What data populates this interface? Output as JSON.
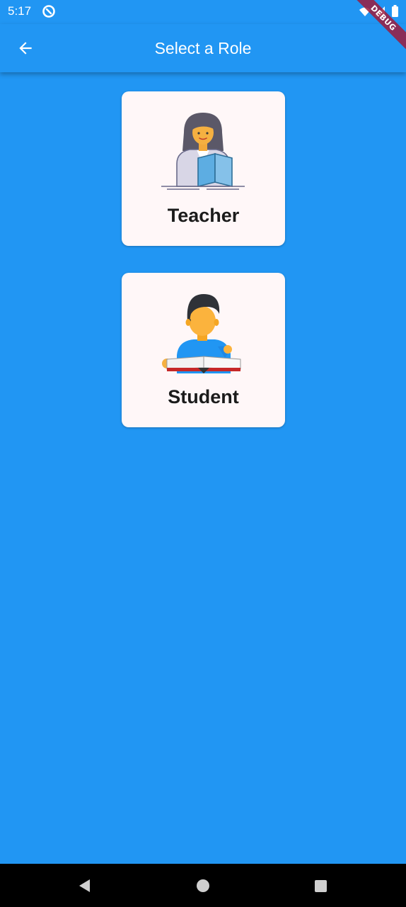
{
  "status_bar": {
    "time": "5:17",
    "icons": [
      "notification-icon",
      "wifi-icon",
      "signal-icon",
      "battery-icon"
    ]
  },
  "app_bar": {
    "title": "Select a Role",
    "back_icon": "arrow-back-icon"
  },
  "debug_banner": {
    "label": "DEBUG"
  },
  "roles": [
    {
      "label": "Teacher",
      "icon": "teacher-illustration"
    },
    {
      "label": "Student",
      "icon": "student-illustration"
    }
  ],
  "nav_bar": {
    "buttons": [
      "back-triangle-icon",
      "home-circle-icon",
      "recents-square-icon"
    ]
  },
  "colors": {
    "primary": "#2196F3",
    "card_background": "#FFF7F8",
    "label_text": "#1b1b1b",
    "debug_ribbon": "#9C1B3C"
  }
}
